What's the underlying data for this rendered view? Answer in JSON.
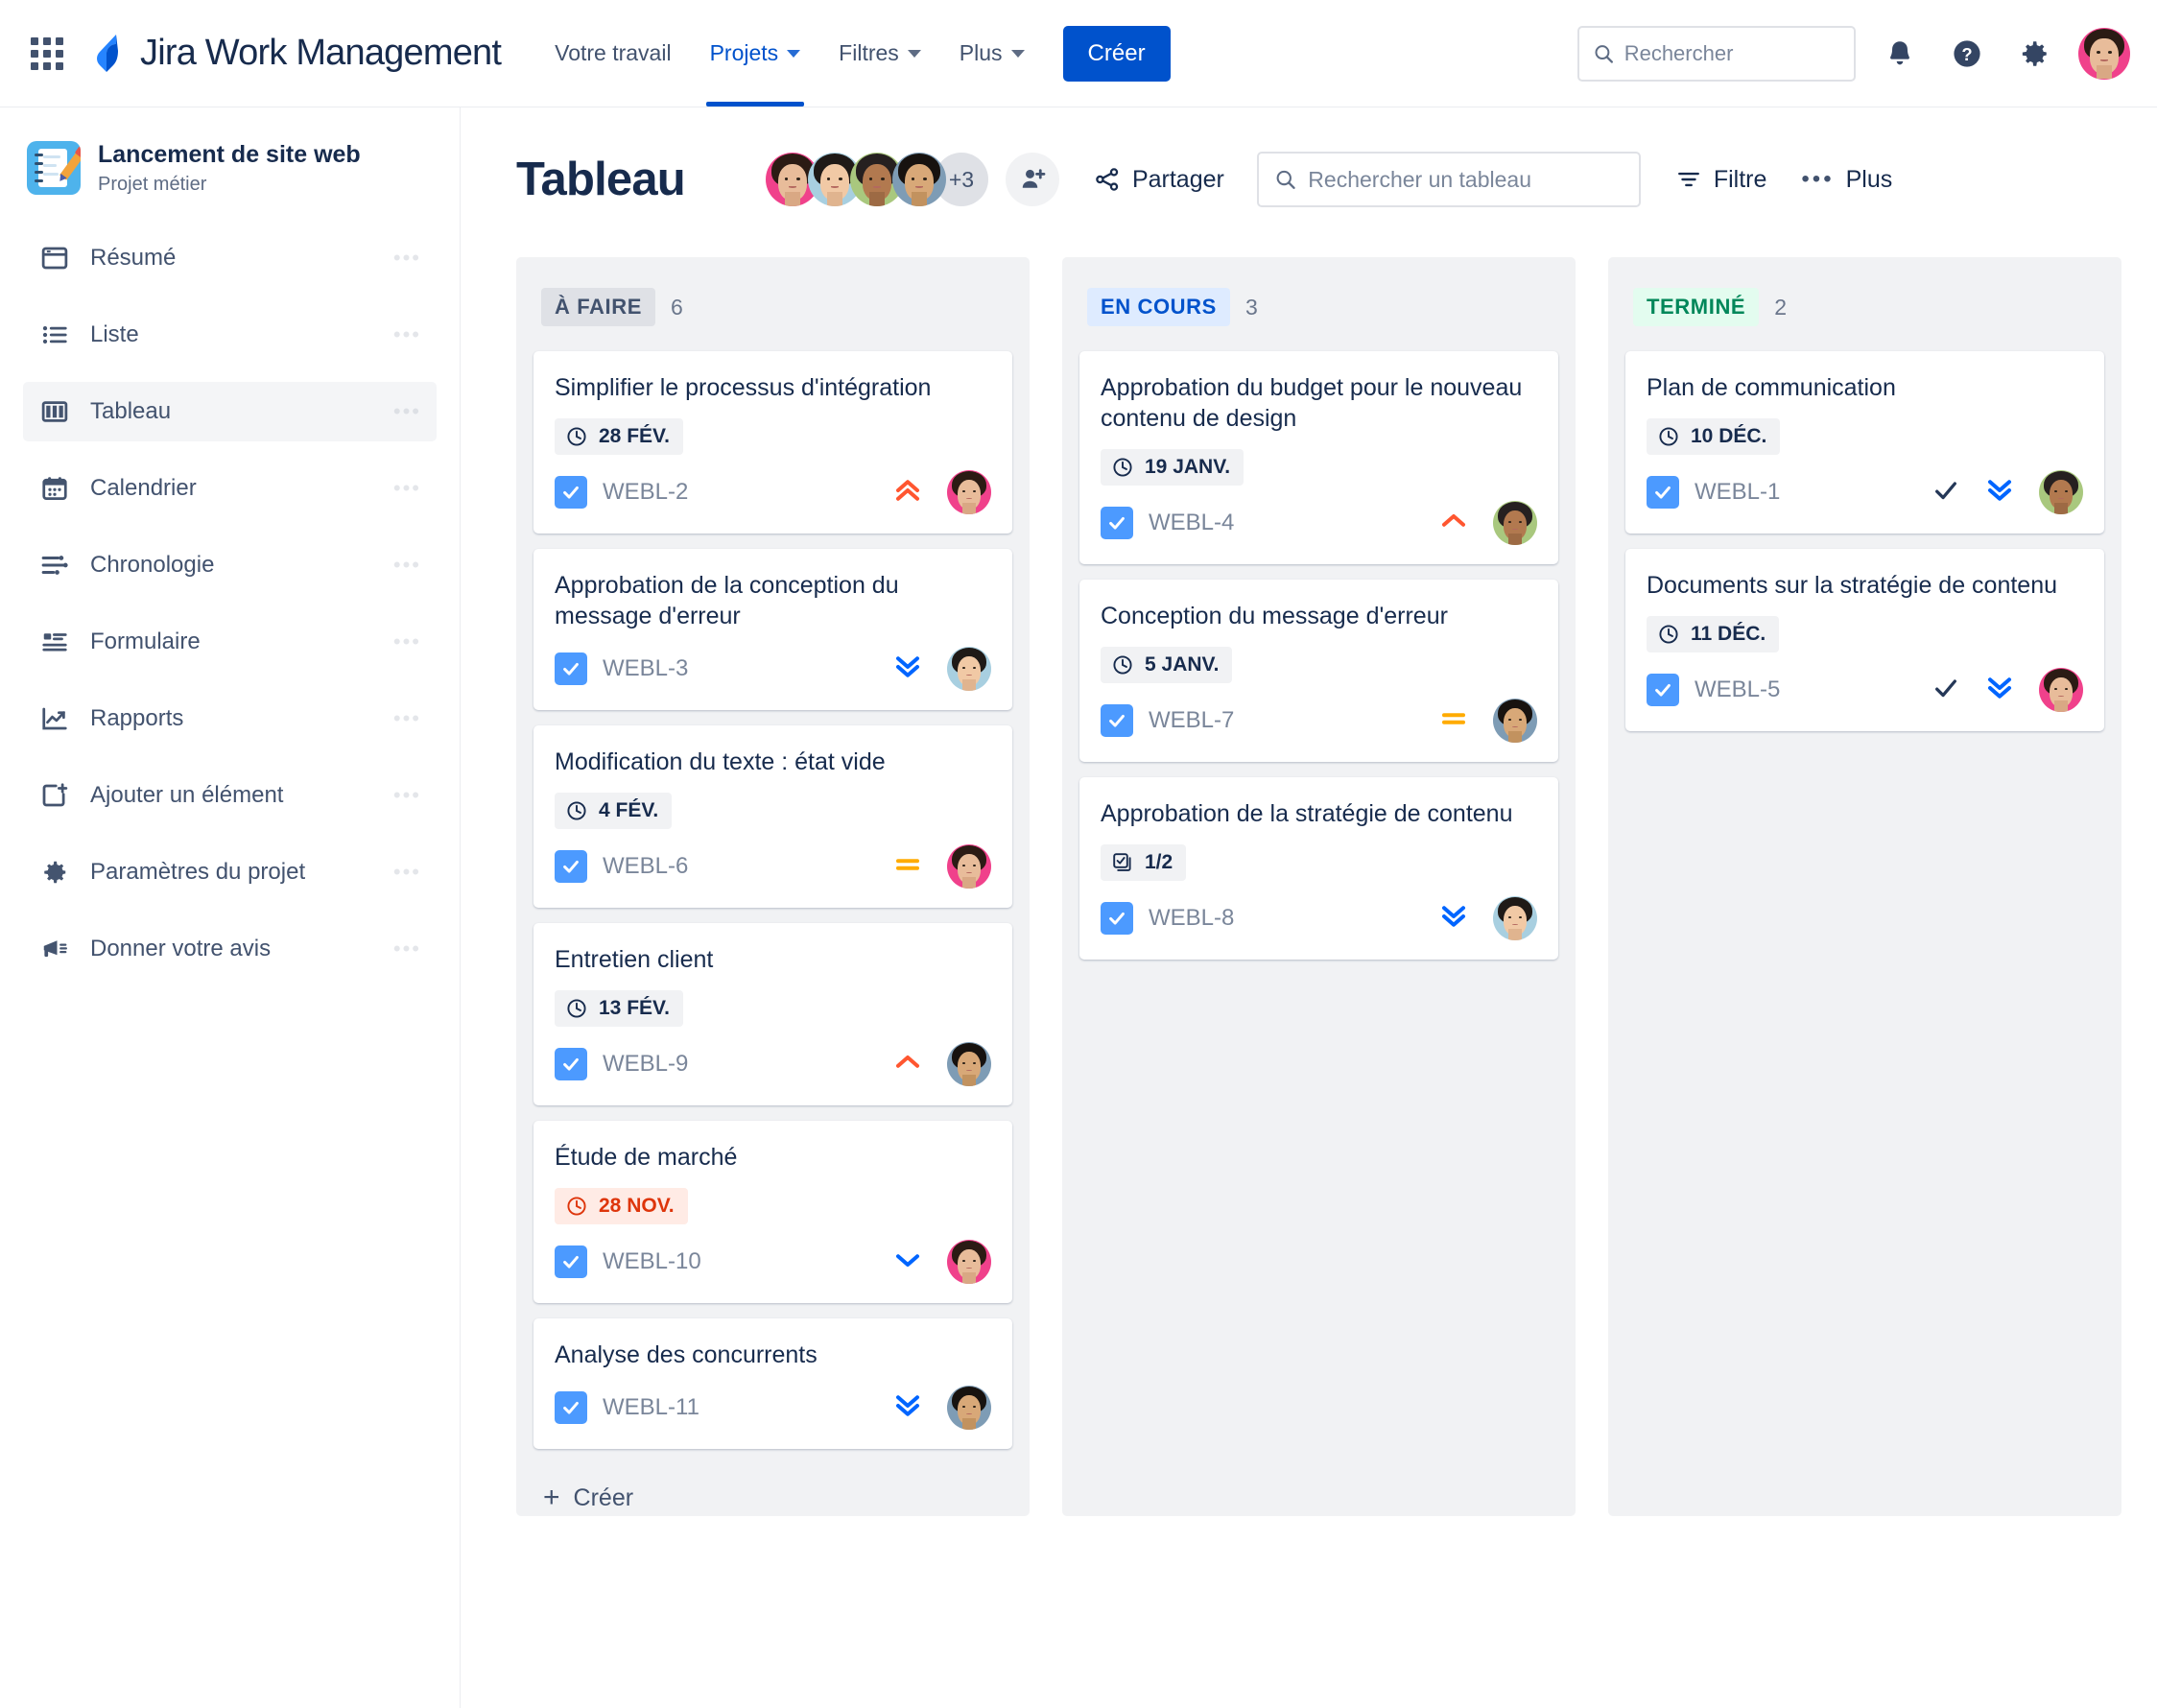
{
  "topnav": {
    "app_grid_icon": "app-switcher-icon",
    "brand": "Jira Work Management",
    "links": [
      {
        "label": "Votre travail",
        "has_caret": false,
        "active": false
      },
      {
        "label": "Projets",
        "has_caret": true,
        "active": true
      },
      {
        "label": "Filtres",
        "has_caret": true,
        "active": false
      },
      {
        "label": "Plus",
        "has_caret": true,
        "active": false
      }
    ],
    "create_label": "Créer",
    "search_placeholder": "Rechercher",
    "search_value": "",
    "icons": [
      "search-icon",
      "notifications-icon",
      "help-icon",
      "settings-icon",
      "profile-avatar"
    ]
  },
  "sidebar": {
    "project_name": "Lancement de site web",
    "project_type": "Projet métier",
    "project_icon": "notebook-pencil-icon",
    "items": [
      {
        "label": "Résumé",
        "icon": "summary-icon",
        "selected": false
      },
      {
        "label": "Liste",
        "icon": "list-icon",
        "selected": false
      },
      {
        "label": "Tableau",
        "icon": "board-icon",
        "selected": true
      },
      {
        "label": "Calendrier",
        "icon": "calendar-icon",
        "selected": false
      },
      {
        "label": "Chronologie",
        "icon": "timeline-icon",
        "selected": false
      },
      {
        "label": "Formulaire",
        "icon": "form-icon",
        "selected": false
      },
      {
        "label": "Rapports",
        "icon": "reports-chart-icon",
        "selected": false
      },
      {
        "label": "Ajouter un élément",
        "icon": "add-item-icon",
        "selected": false
      },
      {
        "label": "Paramètres du projet",
        "icon": "gear-icon",
        "selected": false
      },
      {
        "label": "Donner votre avis",
        "icon": "megaphone-icon",
        "selected": false
      }
    ]
  },
  "board": {
    "title": "Tableau",
    "avatar_overflow": "+3",
    "add_people_icon": "add-person-icon",
    "share_label": "Partager",
    "share_icon": "share-icon",
    "search_placeholder": "Rechercher un tableau",
    "search_value": "",
    "filter_label": "Filtre",
    "filter_icon": "filter-icon",
    "more_label": "Plus",
    "more_icon": "ellipsis-icon",
    "create_row_label": "Créer"
  },
  "colors": {
    "brand_blue": "#0052cc",
    "todo_chip_bg": "#dfe1e6",
    "todo_chip_fg": "#42526e",
    "inprogress_chip_bg": "#deebff",
    "inprogress_chip_fg": "#0052cc",
    "done_chip_bg": "#e3fcef",
    "done_chip_fg": "#00875a",
    "priority_highest": "#ff5630",
    "priority_high": "#ff5630",
    "priority_medium": "#ffab00",
    "priority_low": "#0065ff",
    "priority_lowest": "#0065ff",
    "overdue_bg": "#ffebe5",
    "overdue_fg": "#de350b",
    "column_bg": "#f1f2f4"
  },
  "columns": [
    {
      "name": "À FAIRE",
      "count": "6",
      "style": "todo",
      "cards": [
        {
          "title": "Simplifier le processus d'intégration",
          "date": "28 FÉV.",
          "overdue": false,
          "key": "WEBL-2",
          "priority": "highest",
          "done": false,
          "avatar": "woman-pink",
          "subtasks": ""
        },
        {
          "title": "Approbation de la conception du message d'erreur",
          "date": "",
          "overdue": false,
          "key": "WEBL-3",
          "priority": "lowest",
          "done": false,
          "avatar": "woman-blue",
          "subtasks": ""
        },
        {
          "title": "Modification du texte : état vide",
          "date": "4 FÉV.",
          "overdue": false,
          "key": "WEBL-6",
          "priority": "medium",
          "done": false,
          "avatar": "woman-pink",
          "subtasks": ""
        },
        {
          "title": "Entretien client",
          "date": "13 FÉV.",
          "overdue": false,
          "key": "WEBL-9",
          "priority": "high",
          "done": false,
          "avatar": "man-slate",
          "subtasks": ""
        },
        {
          "title": "Étude de marché",
          "date": "28 NOV.",
          "overdue": true,
          "key": "WEBL-10",
          "priority": "low",
          "done": false,
          "avatar": "woman-pink",
          "subtasks": ""
        },
        {
          "title": "Analyse des concurrents",
          "date": "",
          "overdue": false,
          "key": "WEBL-11",
          "priority": "lowest",
          "done": false,
          "avatar": "man-slate",
          "subtasks": ""
        }
      ]
    },
    {
      "name": "EN COURS",
      "count": "3",
      "style": "inprogress",
      "cards": [
        {
          "title": "Approbation du budget pour le nouveau contenu de design",
          "date": "19 JANV.",
          "overdue": false,
          "key": "WEBL-4",
          "priority": "high",
          "done": false,
          "avatar": "man-green",
          "subtasks": ""
        },
        {
          "title": "Conception du message d'erreur",
          "date": "5 JANV.",
          "overdue": false,
          "key": "WEBL-7",
          "priority": "medium",
          "done": false,
          "avatar": "man-slate",
          "subtasks": ""
        },
        {
          "title": "Approbation de la stratégie de contenu",
          "date": "",
          "overdue": false,
          "key": "WEBL-8",
          "priority": "lowest",
          "done": false,
          "avatar": "woman-blue",
          "subtasks": "1/2"
        }
      ]
    },
    {
      "name": "TERMINÉ",
      "count": "2",
      "style": "done",
      "cards": [
        {
          "title": "Plan de communication",
          "date": "10 DÉC.",
          "overdue": false,
          "key": "WEBL-1",
          "priority": "lowest",
          "done": true,
          "avatar": "man-green",
          "subtasks": ""
        },
        {
          "title": "Documents sur la stratégie de contenu",
          "date": "11 DÉC.",
          "overdue": false,
          "key": "WEBL-5",
          "priority": "lowest",
          "done": true,
          "avatar": "woman-pink",
          "subtasks": ""
        }
      ]
    }
  ]
}
